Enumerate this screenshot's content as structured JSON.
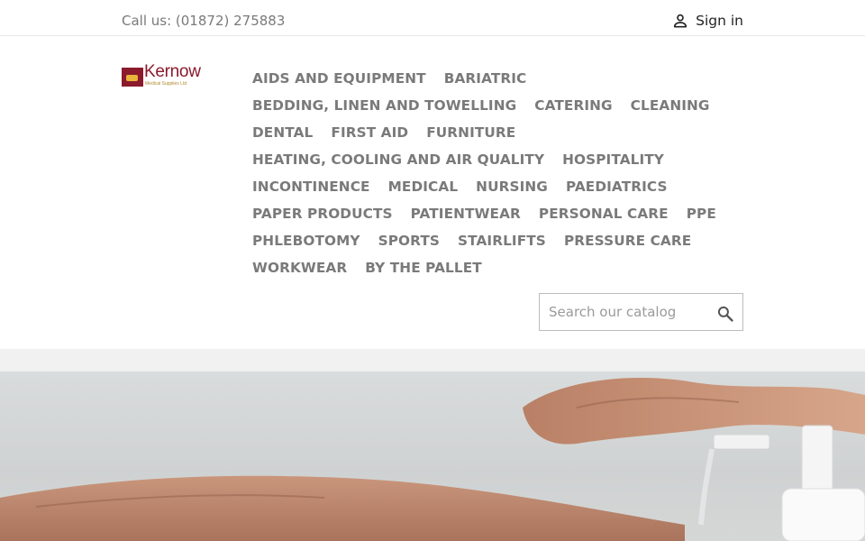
{
  "topbar": {
    "phone": "Call us: (01872) 275883",
    "signin_label": "Sign in",
    "signin_icon": "user-icon"
  },
  "logo": {
    "name": "Kernow",
    "tagline": "Medical Supplies Ltd",
    "brand_color": "#8b1a2c"
  },
  "menu": [
    "AIDS AND EQUIPMENT",
    "BARIATRIC",
    "BEDDING, LINEN AND TOWELLING",
    "CATERING",
    "CLEANING",
    "DENTAL",
    "FIRST AID",
    "FURNITURE",
    "HEATING, COOLING AND AIR QUALITY",
    "HOSPITALITY",
    "INCONTINENCE",
    "MEDICAL",
    "NURSING",
    "PAEDIATRICS",
    "PAPER PRODUCTS",
    "PATIENTWEAR",
    "PERSONAL CARE",
    "PPE",
    "PHLEBOTOMY",
    "SPORTS",
    "STAIRLIFTS",
    "PRESSURE CARE",
    "WORKWEAR",
    "BY THE PALLET"
  ],
  "search": {
    "placeholder": "Search our catalog",
    "value": "",
    "icon": "search-icon"
  },
  "hero": {
    "image": "hand-sanitizer-pump-photo"
  },
  "colors": {
    "menu_text": "#7a7a7a",
    "topbar_text": "#7a7a7a",
    "signin_text": "#232323",
    "strip_bg": "#f1f1f1"
  }
}
